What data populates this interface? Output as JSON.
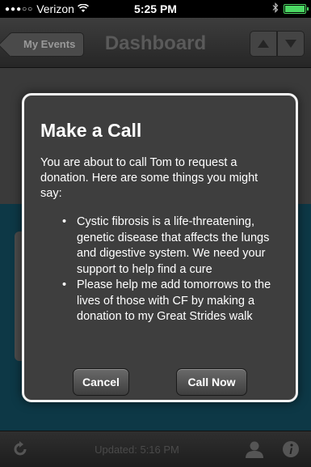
{
  "status_bar": {
    "signal": "●●●○○",
    "carrier": "Verizon",
    "time": "5:25 PM"
  },
  "nav": {
    "back_label": "My Events",
    "title": "Dashboard"
  },
  "toolbar": {
    "updated_text": "Updated: 5:16 PM"
  },
  "dialog": {
    "title": "Make a Call",
    "body": "You are about to call Tom to request a donation. Here are some things you might say:",
    "suggestions": [
      "Cystic fibrosis is a life-threatening, genetic disease that affects the lungs and digestive system. We need your support to help find a cure",
      "Please help me add tomorrows to the lives of those with CF by making a donation to my Great Strides walk"
    ],
    "cancel_label": "Cancel",
    "call_label": "Call Now"
  },
  "icons": {
    "wifi": "wifi-icon",
    "bluetooth": "bluetooth-icon",
    "battery": "battery-icon",
    "refresh": "refresh-icon",
    "person": "person-icon",
    "info": "info-icon",
    "arrow_up": "arrow-up-icon",
    "arrow_down": "arrow-down-icon"
  },
  "colors": {
    "dialog_border": "#f2f2f2",
    "dialog_bg": "#3e3e3e",
    "battery": "#4cd964",
    "teal_background": "#0d3846"
  }
}
